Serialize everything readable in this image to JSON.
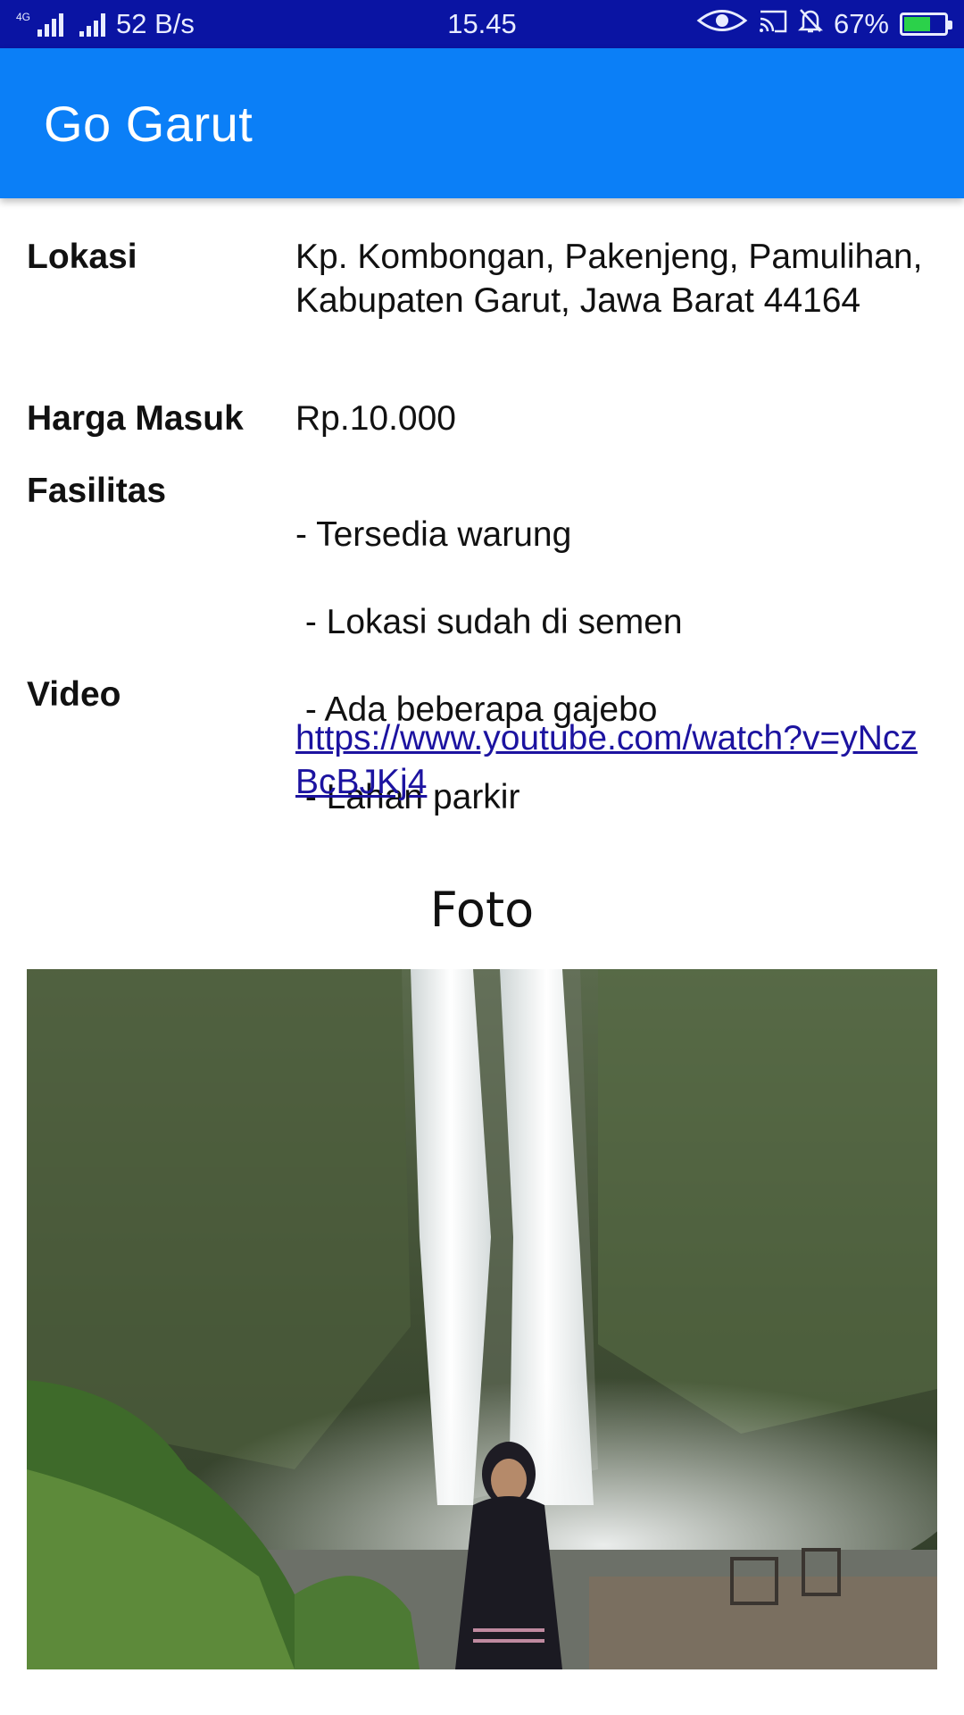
{
  "status_bar": {
    "network": "4G",
    "speed": "52 B/s",
    "time": "15.45",
    "battery": "67%",
    "battery_level": 0.67,
    "icons": [
      "signal-icon",
      "signal-icon",
      "eye-icon",
      "cast-icon",
      "bell-off-icon",
      "battery-charging-icon"
    ]
  },
  "app_bar": {
    "title": "Go Garut",
    "color": "#0b7ff7"
  },
  "details": {
    "lokasi": {
      "label": "Lokasi",
      "value": "Kp. Kombongan, Pakenjeng, Pamulihan, Kabupaten Garut, Jawa Barat 44164"
    },
    "harga": {
      "label": "Harga Masuk",
      "value": "Rp.10.000"
    },
    "fasilitas": {
      "label": "Fasilitas",
      "items": [
        "- Tersedia warung",
        " - Lokasi sudah di semen",
        " - Ada beberapa gajebo",
        " - Lahan parkir"
      ]
    },
    "video": {
      "label": "Video",
      "url": "https://www.youtube.com/watch?v=yNczBcBJKj4"
    }
  },
  "foto": {
    "title": "Foto",
    "image_alt": "waterfall-photo"
  }
}
